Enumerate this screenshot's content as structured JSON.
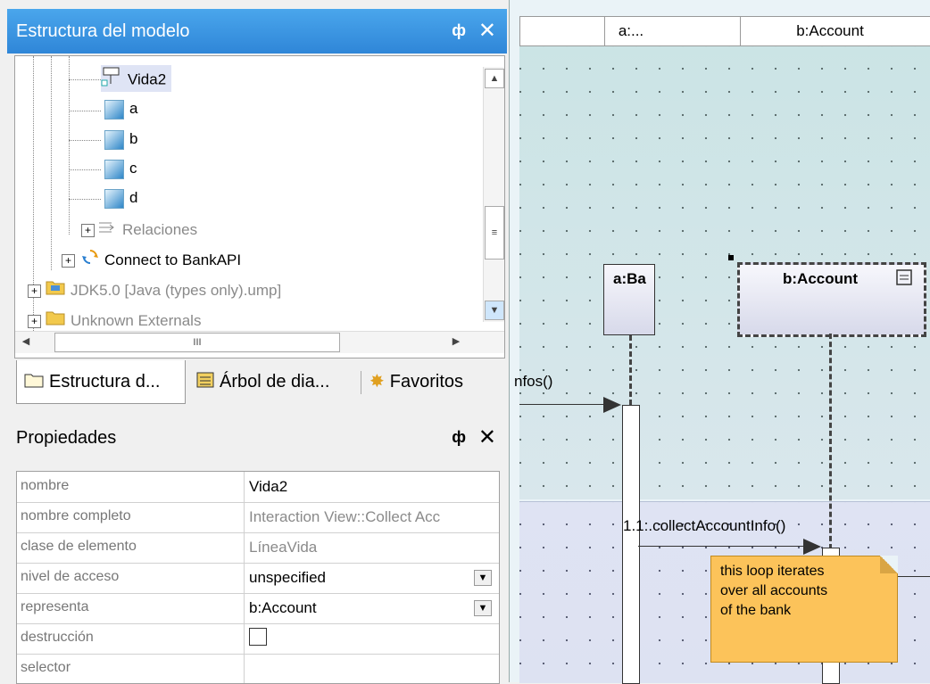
{
  "left_panel": {
    "title": "Estructura del modelo",
    "pin_icon": "ф",
    "close_icon": "✕",
    "tree": [
      {
        "label": "Vida2",
        "icon": "lifeline-icon",
        "selected": true
      },
      {
        "label": "a",
        "icon": "lifeline-icon"
      },
      {
        "label": "b",
        "icon": "lifeline-icon"
      },
      {
        "label": "c",
        "icon": "lifeline-icon"
      },
      {
        "label": "d",
        "icon": "lifeline-icon"
      },
      {
        "label": "Relaciones",
        "icon": "relations-icon",
        "grey": true
      },
      {
        "label": "Connect to BankAPI",
        "icon": "interaction-icon"
      },
      {
        "label": "JDK5.0 [Java (types only).ump]",
        "icon": "package-icon",
        "grey": true
      },
      {
        "label": "Unknown Externals",
        "icon": "folder-icon",
        "grey": true
      }
    ],
    "hscroll_grip": "III",
    "tabs": [
      {
        "label": "Estructura d...",
        "icon": "folder-icon"
      },
      {
        "label": "Árbol de dia...",
        "icon": "diagram-tree-icon"
      },
      {
        "label": "Favoritos",
        "icon": "star-icon"
      }
    ]
  },
  "properties": {
    "title": "Propiedades",
    "pin_icon": "ф",
    "close_icon": "✕",
    "rows": [
      {
        "name": "nombre",
        "value": "Vida2",
        "style": "bold-ish"
      },
      {
        "name": "nombre completo",
        "value": "Interaction View::Collect Acc",
        "style": "grey"
      },
      {
        "name": "clase de elemento",
        "value": "LíneaVida",
        "style": "grey"
      },
      {
        "name": "nivel de acceso",
        "value": "unspecified",
        "dropdown": true
      },
      {
        "name": "representa",
        "value": "b:Account",
        "dropdown": true
      },
      {
        "name": "destrucción",
        "value": "",
        "checkbox": true
      },
      {
        "name": "selector",
        "value": ""
      }
    ]
  },
  "diagram": {
    "header_cells": [
      "a:...",
      "b:Account"
    ],
    "lifeline_a": "a:Ba",
    "lifeline_b": "b:Account",
    "message_1": "nfos()",
    "message_2": "1.1:.collectAccountInfo()",
    "note_lines": [
      "this loop iterates",
      "over all accounts",
      "of the bank"
    ],
    "colors": {
      "panel_title": "#3b93e0",
      "note": "#fcc35a",
      "band_top": "#cbe4e5",
      "band_bottom": "#dfe3f3"
    }
  }
}
